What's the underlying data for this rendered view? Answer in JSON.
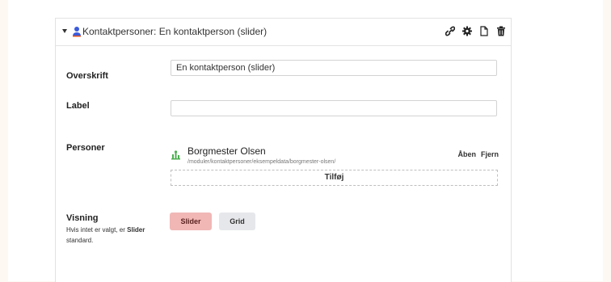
{
  "panel": {
    "header_title": "Kontaktpersoner: En kontaktperson (slider)",
    "icons": [
      "link-icon",
      "gear-icon",
      "copy-icon",
      "trash-icon"
    ]
  },
  "fields": {
    "overskrift": {
      "label": "Overskrift",
      "value": "En kontaktperson (slider)"
    },
    "label": {
      "label": "Label",
      "value": ""
    },
    "personer": {
      "label": "Personer",
      "items": [
        {
          "name": "Borgmester Olsen",
          "path": "/moduler/kontaktpersoner/eksempeldata/borgmester-olsen/",
          "open_label": "Åben",
          "remove_label": "Fjern"
        }
      ],
      "add_label": "Tilføj"
    },
    "visning": {
      "label": "Visning",
      "hint_prefix": "Hvis intet er valgt, er ",
      "hint_strong": "Slider",
      "hint_suffix": "standard.",
      "options": [
        "Slider",
        "Grid"
      ],
      "selected": "Slider"
    }
  },
  "colors": {
    "selected_button": "#f0b7b5",
    "unselected_button": "#e6e7ea",
    "leaf_icon": "#4caf50",
    "person_icon": "#3b5bdb"
  }
}
